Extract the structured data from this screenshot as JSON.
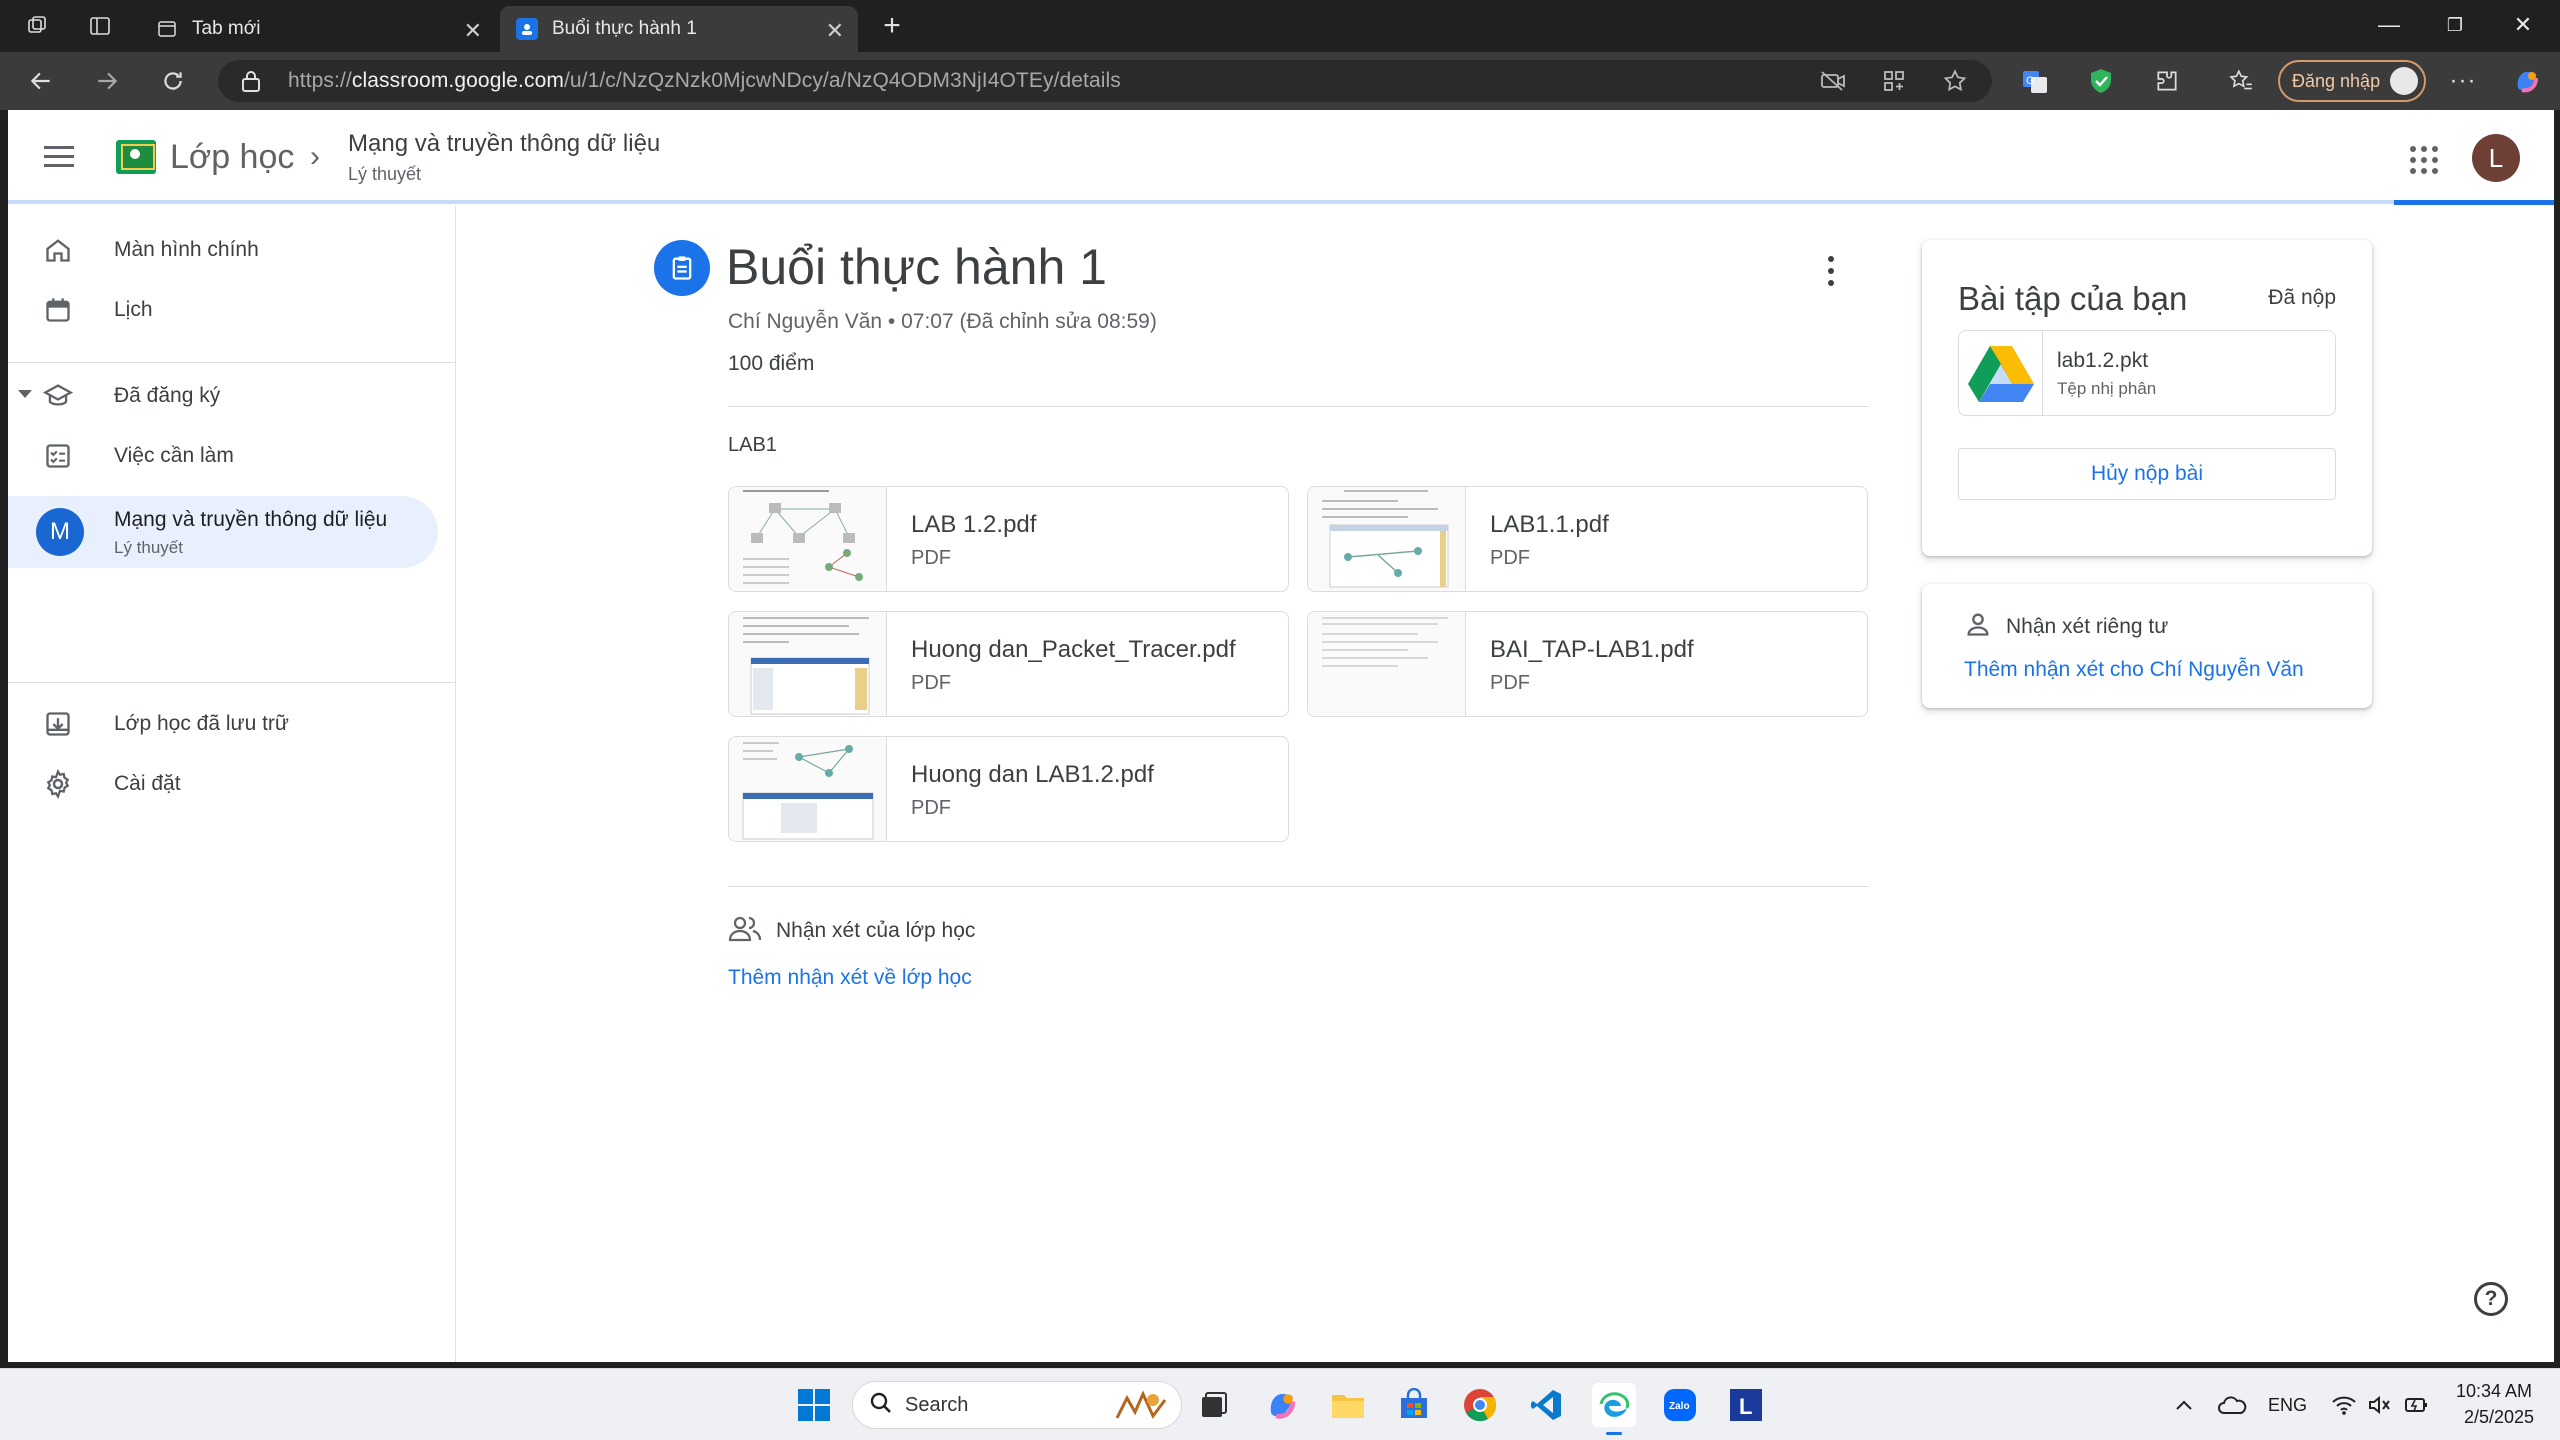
{
  "browser": {
    "tabs": [
      {
        "label": "Tab mới",
        "active": false
      },
      {
        "label": "Buổi thực hành 1",
        "active": true
      }
    ],
    "url_prefix": "https://",
    "url_host": "classroom.google.com",
    "url_path": "/u/1/c/NzQzNzk0MjcwNDcy/a/NzQ4ODM3NjI4OTEy/details",
    "signin_label": "Đăng nhập"
  },
  "header": {
    "brand": "Lớp học",
    "class_title": "Mạng và truyền thông dữ liệu",
    "class_subtitle": "Lý thuyết",
    "user_initial": "L"
  },
  "sidebar": {
    "items": [
      {
        "label": "Màn hình chính",
        "icon": "home-icon"
      },
      {
        "label": "Lịch",
        "icon": "calendar-icon"
      },
      {
        "label": "Đã đăng ký",
        "icon": "school-icon"
      },
      {
        "label": "Việc cần làm",
        "icon": "todo-icon"
      },
      {
        "label": "Lớp học đã lưu trữ",
        "icon": "archive-icon"
      },
      {
        "label": "Cài đặt",
        "icon": "gear-icon"
      }
    ],
    "course": {
      "initial": "M",
      "name": "Mạng và truyền thông dữ liệu",
      "sub": "Lý thuyết"
    }
  },
  "assignment": {
    "title": "Buổi thực hành 1",
    "meta": "Chí Nguyễn Văn • 07:07 (Đã chỉnh sửa 08:59)",
    "points": "100 điểm",
    "description": "LAB1",
    "attachments": [
      {
        "name": "LAB 1.2.pdf",
        "type": "PDF"
      },
      {
        "name": "LAB1.1.pdf",
        "type": "PDF"
      },
      {
        "name": "Huong dan_Packet_Tracer.pdf",
        "type": "PDF"
      },
      {
        "name": "BAI_TAP-LAB1.pdf",
        "type": "PDF"
      },
      {
        "name": "Huong dan LAB1.2.pdf",
        "type": "PDF"
      }
    ],
    "class_comments_label": "Nhận xét của lớp học",
    "add_class_comment": "Thêm nhận xét về lớp học"
  },
  "your_work": {
    "title": "Bài tập của bạn",
    "status": "Đã nộp",
    "file_name": "lab1.2.pkt",
    "file_type": "Tệp nhị phân",
    "unsubmit_label": "Hủy nộp bài"
  },
  "private_comments": {
    "label": "Nhận xét riêng tư",
    "add_label": "Thêm nhận xét cho Chí Nguyễn Văn"
  },
  "taskbar": {
    "search_label": "Search",
    "lang": "ENG",
    "time": "10:34 AM",
    "date": "2/5/2025"
  },
  "colors": {
    "accent": "#1a73e8",
    "course_avatar": "#1967d2",
    "user_avatar": "#6d3f35",
    "selected_bg": "#e8f0fe"
  }
}
